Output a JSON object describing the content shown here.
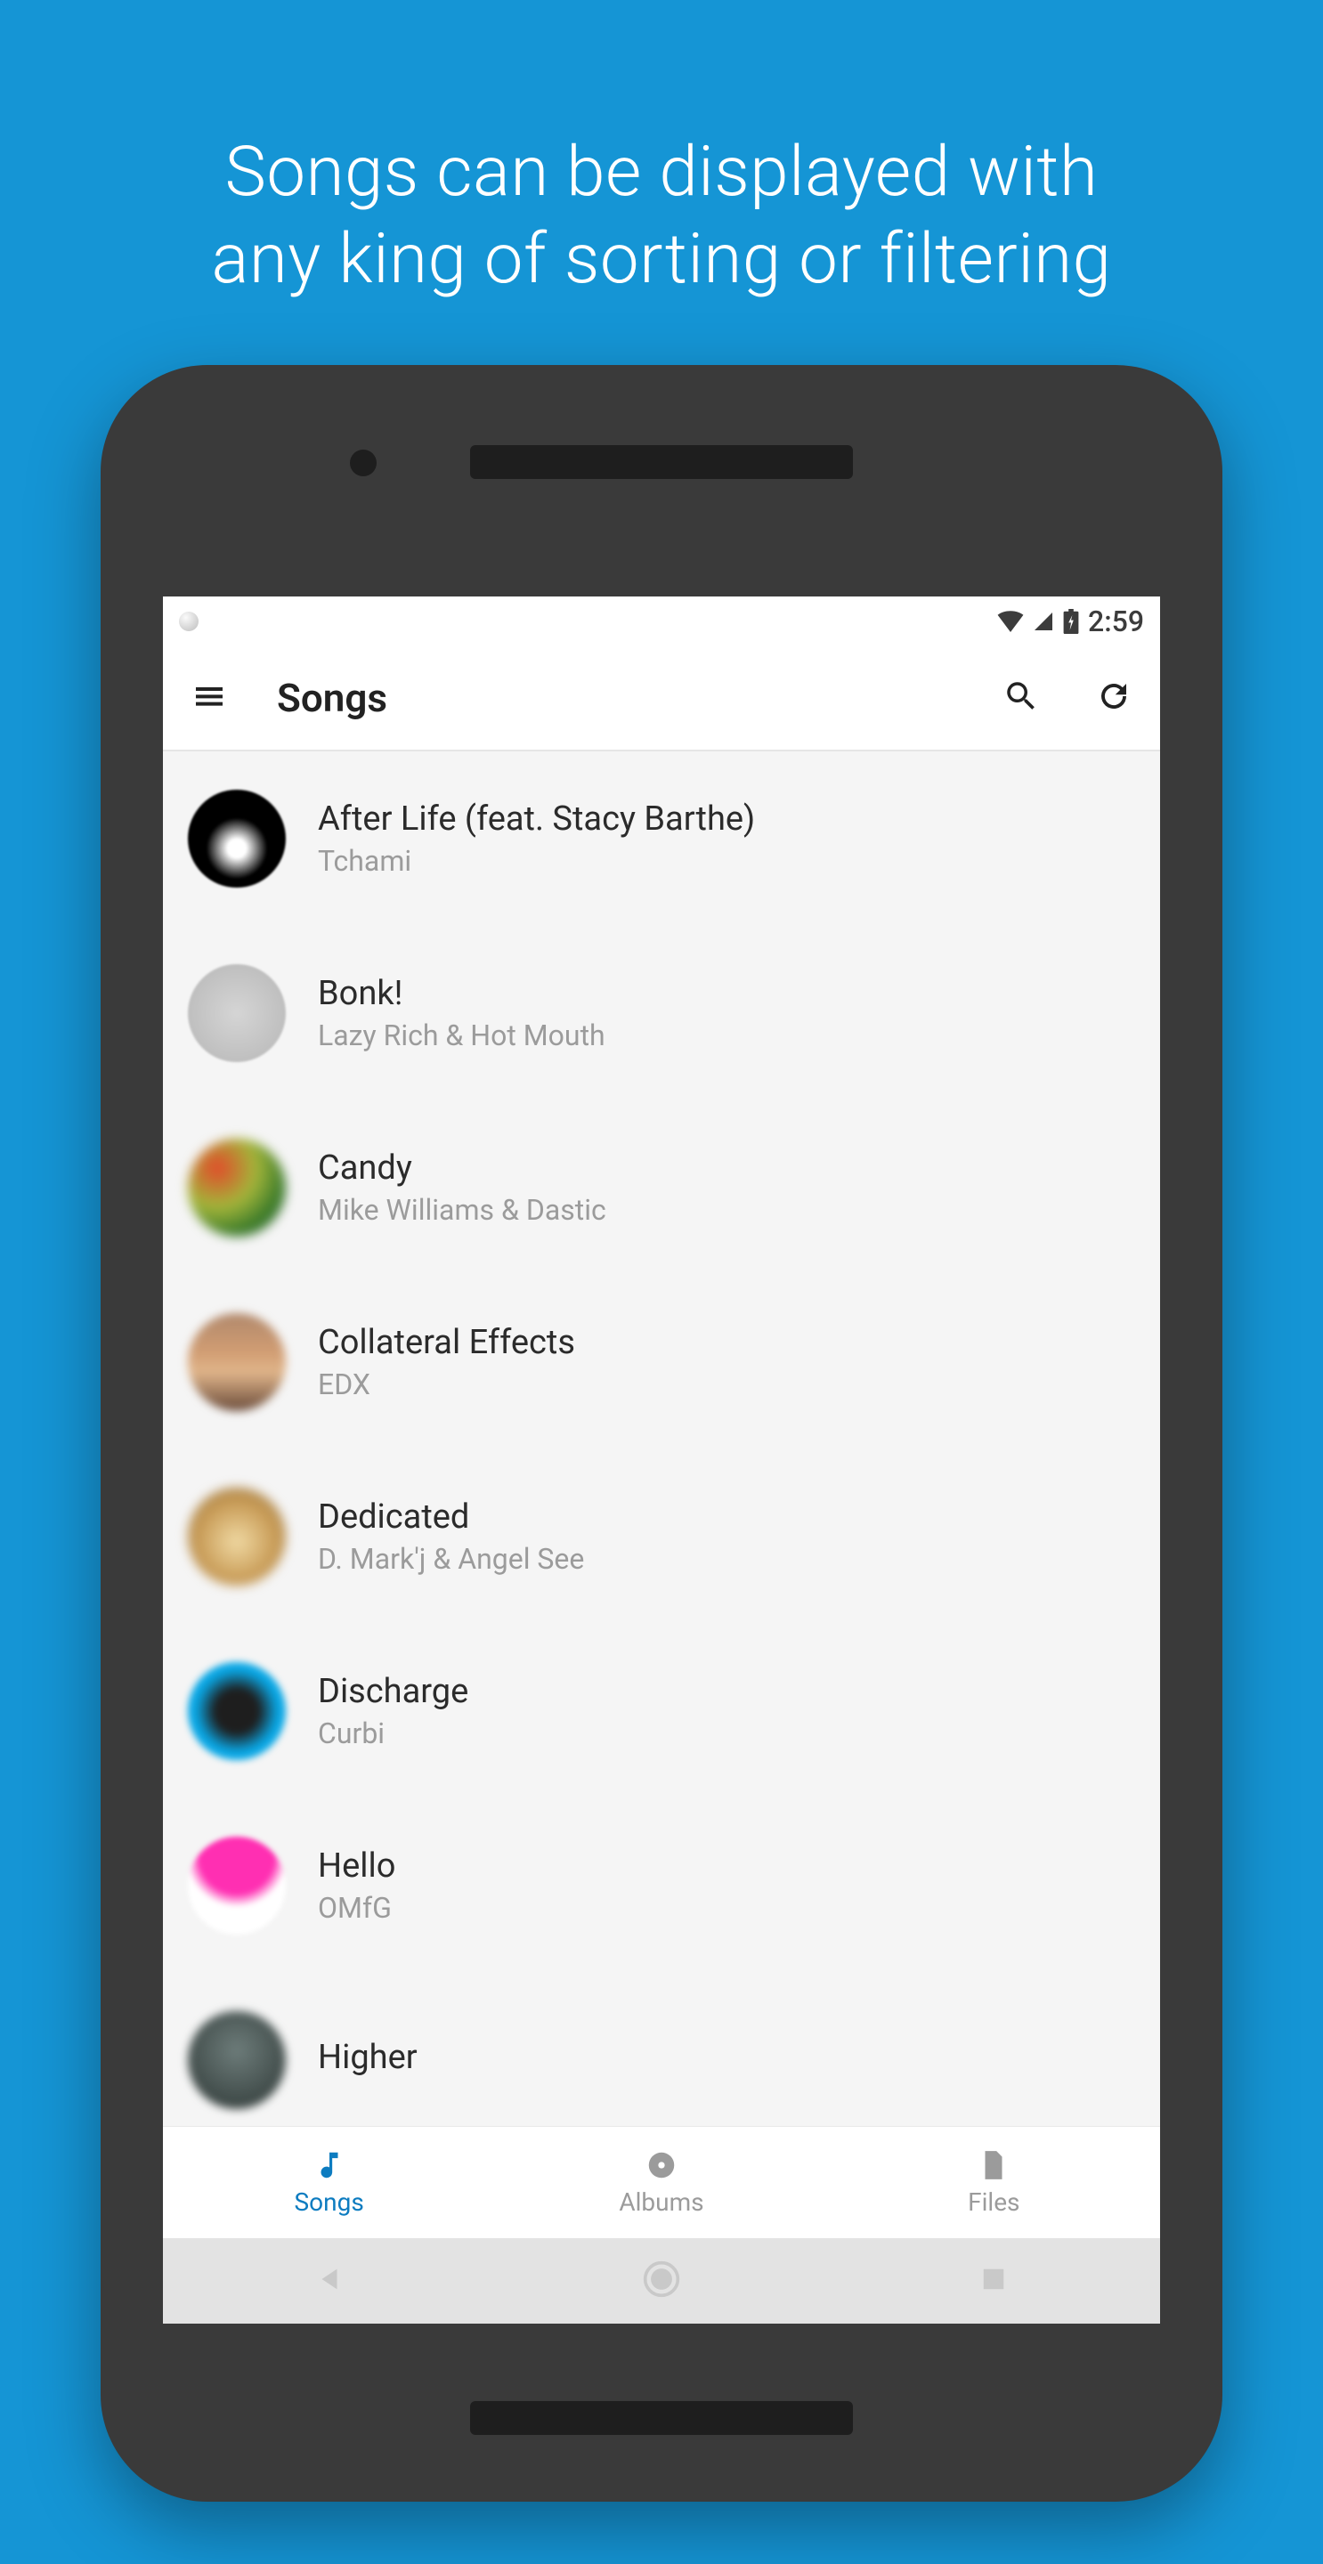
{
  "promo": {
    "line1": "Songs can be displayed with",
    "line2": "any king of sorting or filtering"
  },
  "status_bar": {
    "time": "2:59"
  },
  "app_bar": {
    "title": "Songs"
  },
  "songs": [
    {
      "title": "After Life (feat. Stacy Barthe)",
      "artist": "Tchami"
    },
    {
      "title": "Bonk!",
      "artist": "Lazy Rich & Hot Mouth"
    },
    {
      "title": "Candy",
      "artist": "Mike Williams & Dastic"
    },
    {
      "title": "Collateral Effects",
      "artist": "EDX"
    },
    {
      "title": "Dedicated",
      "artist": "D. Mark'j & Angel See"
    },
    {
      "title": "Discharge",
      "artist": "Curbi"
    },
    {
      "title": "Hello",
      "artist": "OMfG"
    },
    {
      "title": "Higher",
      "artist": ""
    }
  ],
  "tabs": {
    "songs": "Songs",
    "albums": "Albums",
    "files": "Files"
  },
  "colors": {
    "background": "#1595d5",
    "accent": "#0d7cc0"
  }
}
